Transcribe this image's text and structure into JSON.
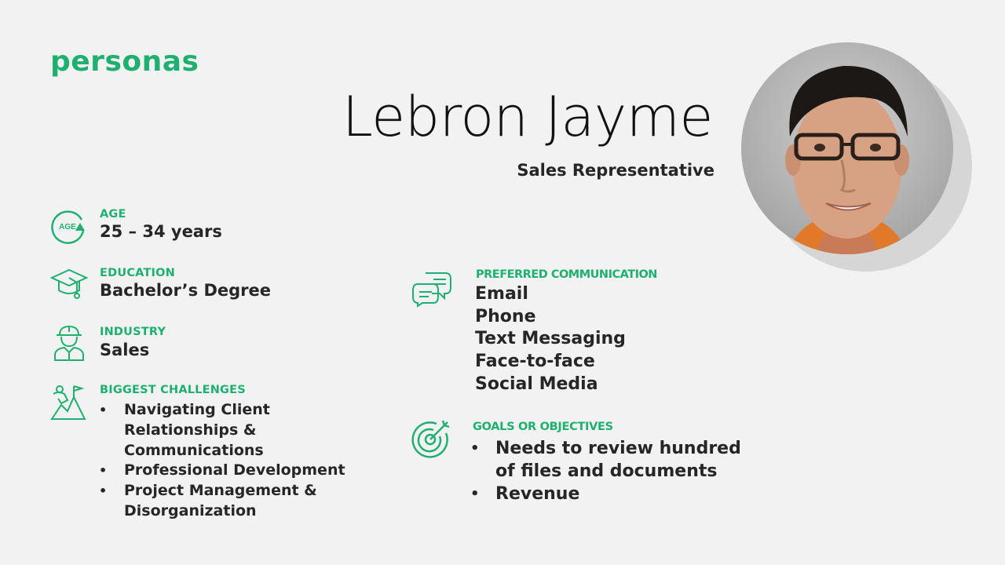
{
  "brand": "personas",
  "persona": {
    "name": "Lebron Jayme",
    "role": "Sales Representative"
  },
  "age": {
    "label": "AGE",
    "icon_text": "AGE",
    "value": "25 – 34 years"
  },
  "education": {
    "label": "EDUCATION",
    "value": "Bachelor’s Degree"
  },
  "industry": {
    "label": "INDUSTRY",
    "value": "Sales"
  },
  "challenges": {
    "label": "BIGGEST CHALLENGES",
    "items": [
      "Navigating Client Relationships & Communications",
      "Professional Development",
      "Project Management & Disorganization"
    ]
  },
  "communication": {
    "label": "PREFERRED COMMUNICATION",
    "items": [
      "Email",
      "Phone",
      "Text Messaging",
      "Face-to-face",
      "Social Media"
    ]
  },
  "goals": {
    "label": "GOALS OR OBJECTIVES",
    "items": [
      "Needs to review hundred of files and documents",
      "Revenue"
    ]
  },
  "colors": {
    "accent": "#1fb070",
    "background": "#f2f2f2",
    "text": "#262626"
  },
  "icons": {
    "age": "age-icon",
    "education": "graduation-cap-icon",
    "industry": "worker-icon",
    "challenges": "climber-icon",
    "communication": "chat-bubbles-icon",
    "goals": "target-icon"
  }
}
